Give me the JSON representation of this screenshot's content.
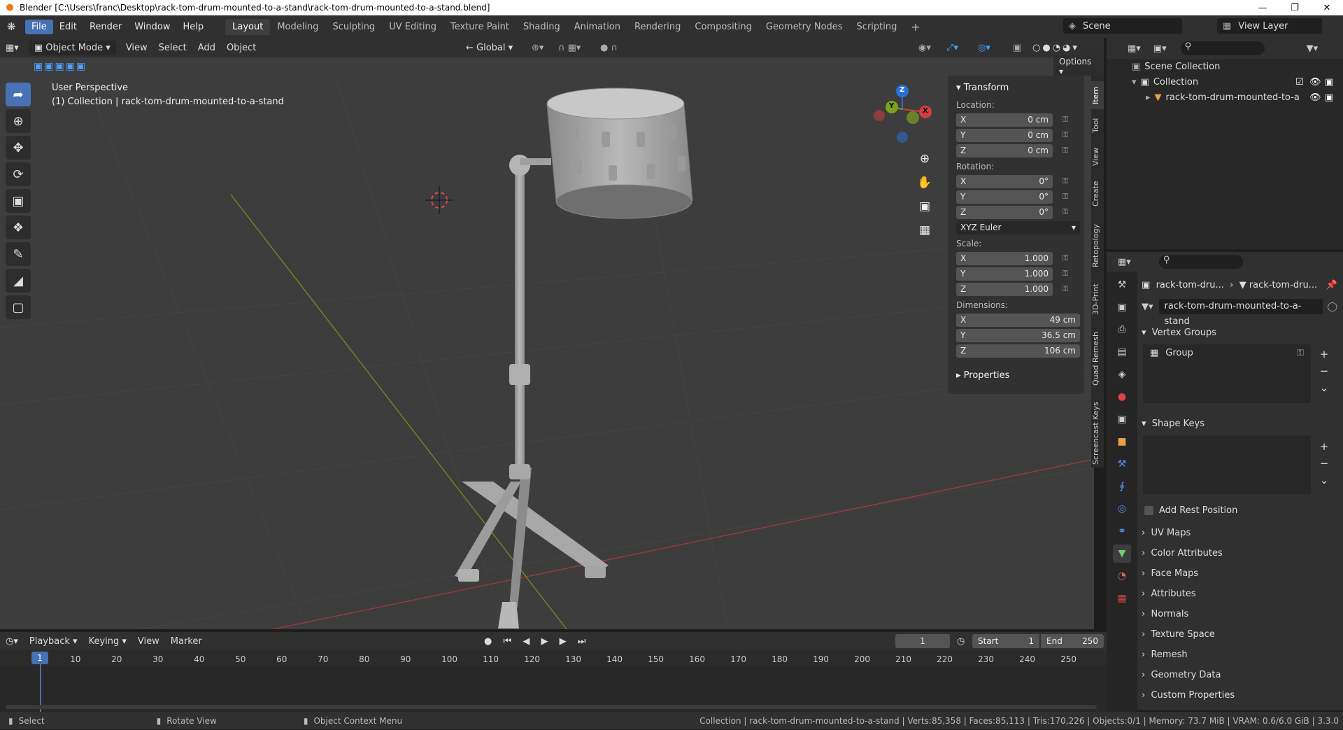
{
  "window": {
    "title": "Blender [C:\\Users\\franc\\Desktop\\rack-tom-drum-mounted-to-a-stand\\rack-tom-drum-mounted-to-a-stand.blend]",
    "minimize": "—",
    "maximize": "❐",
    "close": "✕"
  },
  "menu": {
    "items": [
      "File",
      "Edit",
      "Render",
      "Window",
      "Help"
    ]
  },
  "workspaces": {
    "tabs": [
      "Layout",
      "Modeling",
      "Sculpting",
      "UV Editing",
      "Texture Paint",
      "Shading",
      "Animation",
      "Rendering",
      "Compositing",
      "Geometry Nodes",
      "Scripting"
    ],
    "add": "+"
  },
  "scene": {
    "name": "Scene"
  },
  "view_layer": {
    "name": "View Layer"
  },
  "viewport_header": {
    "mode": "Object Mode",
    "menus": [
      "View",
      "Select",
      "Add",
      "Object"
    ],
    "transform_orientation": "Global",
    "options": "Options"
  },
  "viewport": {
    "perspective_label": "User Perspective",
    "collection_label": "(1) Collection | rack-tom-drum-mounted-to-a-stand",
    "gizmo_axes": {
      "x": "X",
      "y": "Y",
      "z": "Z"
    }
  },
  "npanel": {
    "transform_title": "Transform",
    "location_label": "Location:",
    "location": [
      {
        "axis": "X",
        "value": "0 cm"
      },
      {
        "axis": "Y",
        "value": "0 cm"
      },
      {
        "axis": "Z",
        "value": "0 cm"
      }
    ],
    "rotation_label": "Rotation:",
    "rotation": [
      {
        "axis": "X",
        "value": "0°"
      },
      {
        "axis": "Y",
        "value": "0°"
      },
      {
        "axis": "Z",
        "value": "0°"
      }
    ],
    "rotation_mode": "XYZ Euler",
    "scale_label": "Scale:",
    "scale": [
      {
        "axis": "X",
        "value": "1.000"
      },
      {
        "axis": "Y",
        "value": "1.000"
      },
      {
        "axis": "Z",
        "value": "1.000"
      }
    ],
    "dimensions_label": "Dimensions:",
    "dimensions": [
      {
        "axis": "X",
        "value": "49 cm"
      },
      {
        "axis": "Y",
        "value": "36.5 cm"
      },
      {
        "axis": "Z",
        "value": "106 cm"
      }
    ],
    "properties_label": "Properties"
  },
  "sidebar_tabs": [
    "Item",
    "Tool",
    "View",
    "Create",
    "Retopology",
    "3D-Print",
    "Quad Remesh",
    "Screencast Keys"
  ],
  "outliner": {
    "scene_collection": "Scene Collection",
    "collection": "Collection",
    "object": "rack-tom-drum-mounted-to-a"
  },
  "properties": {
    "breadcrumb_object": "rack-tom-dru...",
    "breadcrumb_mesh": "rack-tom-dru...",
    "mesh_name": "rack-tom-drum-mounted-to-a-stand",
    "vertex_groups_title": "Vertex Groups",
    "vertex_group_item": "Group",
    "shape_keys_title": "Shape Keys",
    "add_rest_position": "Add Rest Position",
    "sections": [
      "UV Maps",
      "Color Attributes",
      "Face Maps",
      "Attributes",
      "Normals",
      "Texture Space",
      "Remesh",
      "Geometry Data",
      "Custom Properties"
    ]
  },
  "timeline": {
    "menus": [
      "Playback",
      "Keying",
      "View",
      "Marker"
    ],
    "current_frame": "1",
    "start_label": "Start",
    "start": "1",
    "end_label": "End",
    "end": "250",
    "ruler": [
      "1",
      "10",
      "20",
      "30",
      "40",
      "50",
      "60",
      "70",
      "80",
      "90",
      "100",
      "110",
      "120",
      "130",
      "140",
      "150",
      "160",
      "170",
      "180",
      "190",
      "200",
      "210",
      "220",
      "230",
      "240",
      "250"
    ]
  },
  "statusbar": {
    "hint_select": "Select",
    "hint_rotate": "Rotate View",
    "hint_context": "Object Context Menu",
    "stats": "Collection | rack-tom-drum-mounted-to-a-stand | Verts:85,358 | Faces:85,113 | Tris:170,226 | Objects:0/1 | Memory: 73.7 MiB | VRAM: 0.6/6.0 GiB | 3.3.0"
  }
}
